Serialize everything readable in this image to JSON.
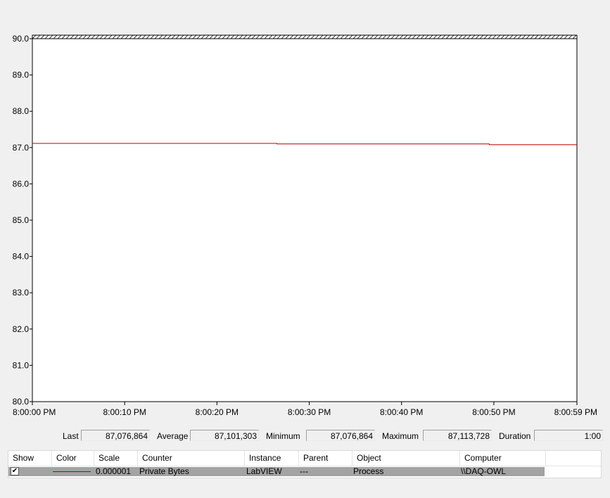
{
  "chart_data": {
    "type": "line",
    "x_ticks": [
      "8:00:00 PM",
      "8:00:10 PM",
      "8:00:20 PM",
      "8:00:30 PM",
      "8:00:40 PM",
      "8:00:50 PM",
      "8:00:59 PM"
    ],
    "xlim": [
      0,
      59
    ],
    "y_ticks": [
      "80.0",
      "81.0",
      "82.0",
      "83.0",
      "84.0",
      "85.0",
      "86.0",
      "87.0",
      "88.0",
      "89.0",
      "90.0"
    ],
    "ylim": [
      80,
      90
    ],
    "grid": false,
    "series": [
      {
        "color": "#c00000",
        "x": [
          0,
          26.5,
          26.5,
          49.5,
          49.5,
          59
        ],
        "y": [
          87.114,
          87.114,
          87.101,
          87.101,
          87.077,
          87.077
        ]
      }
    ]
  },
  "stats": {
    "last_label": "Last",
    "last_value": "87,076,864",
    "average_label": "Average",
    "average_value": "87,101,303",
    "minimum_label": "Minimum",
    "minimum_value": "87,076,864",
    "maximum_label": "Maximum",
    "maximum_value": "87,113,728",
    "duration_label": "Duration",
    "duration_value": "1:00"
  },
  "legend": {
    "headers": [
      "Show",
      "Color",
      "Scale",
      "Counter",
      "Instance",
      "Parent",
      "Object",
      "Computer"
    ],
    "row": {
      "checked_glyph": "✔",
      "line_color": "#c00000",
      "scale": "0.000001",
      "counter": "Private Bytes",
      "instance": "LabVIEW",
      "parent": "---",
      "object": "Process",
      "computer": "\\\\DAQ-OWL"
    }
  }
}
